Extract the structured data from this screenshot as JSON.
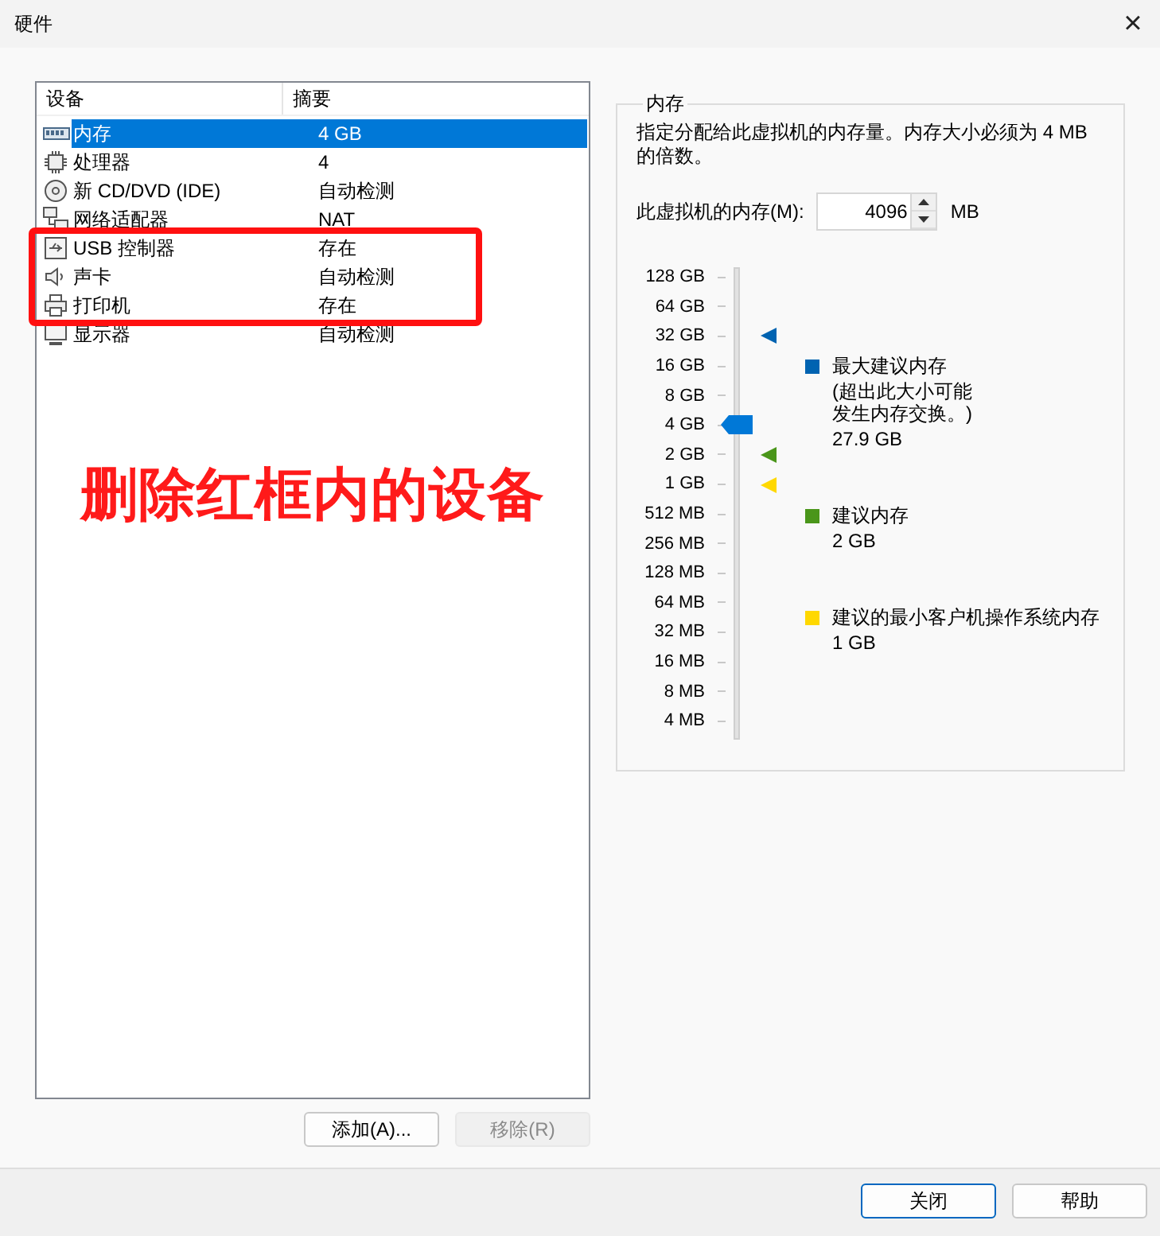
{
  "window": {
    "title": "硬件",
    "close": "×"
  },
  "device_list": {
    "columns": [
      "设备",
      "摘要"
    ],
    "rows": [
      {
        "kind": "memory",
        "name": "内存",
        "summary": "4 GB",
        "selected": true,
        "highlighted": false
      },
      {
        "kind": "cpu",
        "name": "处理器",
        "summary": "4",
        "selected": false,
        "highlighted": false
      },
      {
        "kind": "disc",
        "name": "新 CD/DVD (IDE)",
        "summary": "自动检测",
        "selected": false,
        "highlighted": false
      },
      {
        "kind": "network",
        "name": "网络适配器",
        "summary": "NAT",
        "selected": false,
        "highlighted": false
      },
      {
        "kind": "usb",
        "name": "USB 控制器",
        "summary": "存在",
        "selected": false,
        "highlighted": true
      },
      {
        "kind": "sound",
        "name": "声卡",
        "summary": "自动检测",
        "selected": false,
        "highlighted": true
      },
      {
        "kind": "printer",
        "name": "打印机",
        "summary": "存在",
        "selected": false,
        "highlighted": true
      },
      {
        "kind": "display",
        "name": "显示器",
        "summary": "自动检测",
        "selected": false,
        "highlighted": false
      }
    ],
    "annotation": "删除红框内的设备"
  },
  "list_buttons": [
    {
      "label": "添加(A)...",
      "disabled": false
    },
    {
      "label": "移除(R)",
      "disabled": true
    }
  ],
  "memory": {
    "title": "内存",
    "description": "指定分配给此虚拟机的内存量。内存大小必须为 4 MB 的倍数。",
    "field_label": "此虚拟机的内存(M):",
    "value": "4096",
    "unit": "MB",
    "scale": [
      "128 GB",
      "64 GB",
      "32 GB",
      "16 GB",
      "8 GB",
      "4 GB",
      "2 GB",
      "1 GB",
      "512 MB",
      "256 MB",
      "128 MB",
      "64 MB",
      "32 MB",
      "16 MB",
      "8 MB",
      "4 MB"
    ],
    "level": 0.6667,
    "legend": [
      {
        "label": "最大建议内存",
        "note": "(超出此大小可能发生内存交换。)",
        "value": "27.9 GB",
        "color": "#0063b1"
      },
      {
        "label": "建议内存",
        "value": "2 GB",
        "color": "#4a961a"
      },
      {
        "label": "建议的最小客户机操作系统内存",
        "value": "1 GB",
        "color": "#ffd800"
      }
    ],
    "markers": [
      {
        "color": "#0063b1",
        "level": 0.8667
      },
      {
        "color": "#4a961a",
        "level": 0.6
      },
      {
        "color": "#ffd800",
        "level": 0.5333
      }
    ]
  },
  "dialog_buttons": [
    {
      "label": "关闭",
      "default": true
    },
    {
      "label": "帮助",
      "default": false
    }
  ]
}
